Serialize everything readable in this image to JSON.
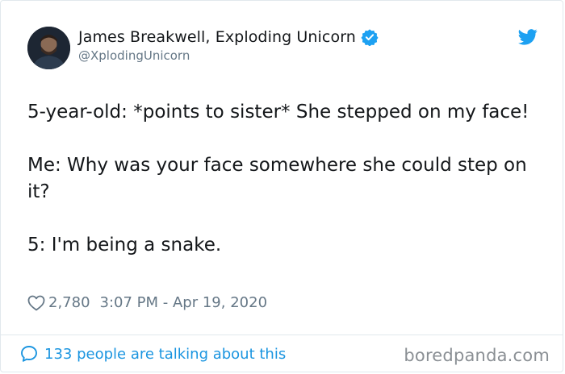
{
  "author": {
    "display_name": "James Breakwell, Exploding Unicorn",
    "handle": "@XplodingUnicorn",
    "verified": true,
    "avatar_icon": "avatar-photo"
  },
  "tweet": {
    "lines": [
      "5-year-old: *points to sister* She stepped on my face!",
      "Me: Why was your face somewhere she could step on it?",
      "5: I'm being a snake."
    ],
    "likes": "2,780",
    "timestamp": "3:07 PM - Apr 19, 2020"
  },
  "footer": {
    "conversation_link": "133 people are talking about this"
  },
  "watermark": "boredpanda.com",
  "colors": {
    "twitter_blue": "#1da1f2",
    "link_blue": "#1b95e0",
    "muted_gray": "#657786",
    "text_dark": "#14171a",
    "border": "#e1e8ed"
  },
  "icons": {
    "verified": "verified-badge-icon",
    "brand": "twitter-bird-icon",
    "like": "heart-icon",
    "reply": "speech-bubble-icon"
  }
}
